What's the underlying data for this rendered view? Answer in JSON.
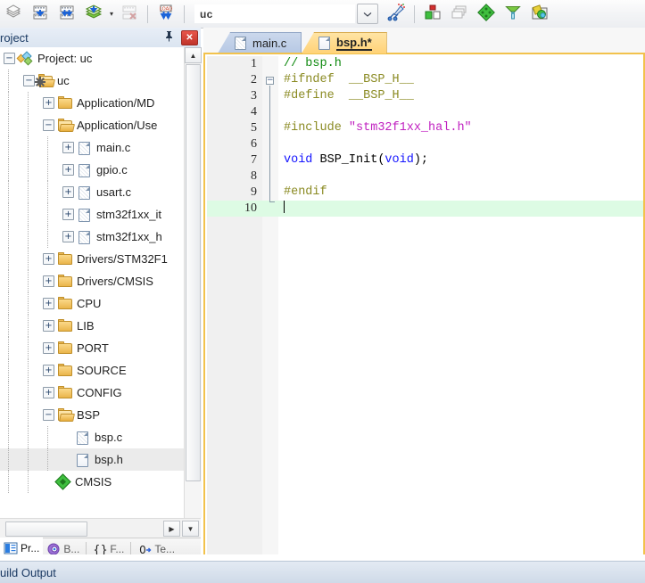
{
  "toolbar": {
    "buttons": [
      {
        "name": "translate-icon",
        "title": "Translate"
      },
      {
        "name": "build-icon",
        "title": "Build"
      },
      {
        "name": "rebuild-icon",
        "title": "Rebuild"
      },
      {
        "name": "batch-build-icon",
        "title": "Batch Build"
      },
      {
        "name": "stop-build-icon",
        "title": "Stop Build"
      },
      {
        "name": "download-icon",
        "title": "Download"
      },
      {
        "name": "target-options-icon",
        "title": "Options for Target"
      },
      {
        "name": "manage-project-items-icon",
        "title": "Manage Project Items"
      },
      {
        "name": "manage-run-time-env-icon",
        "title": "Manage Run-Time Environment"
      },
      {
        "name": "pack-installer-icon",
        "title": "Pack Installer"
      },
      {
        "name": "configuration-wizard-icon",
        "title": "Configuration Wizard"
      }
    ],
    "target_select": {
      "value": "uc",
      "dropdown_icon": "chevron-down-icon"
    },
    "dropdown_caret": "▾"
  },
  "project_panel": {
    "title": "roject",
    "pin_icon": "pin-icon",
    "close_icon": "close-icon",
    "tree": [
      {
        "label": "Project: uc",
        "depth": 0,
        "expander": "minus",
        "icon": "project-root-icon"
      },
      {
        "label": "uc",
        "depth": 1,
        "expander": "minus",
        "icon": "target-folder-icon"
      },
      {
        "label": "Application/MD",
        "depth": 2,
        "expander": "plus",
        "icon": "folder-closed-icon"
      },
      {
        "label": "Application/Use",
        "depth": 2,
        "expander": "minus",
        "icon": "folder-open-icon"
      },
      {
        "label": "main.c",
        "depth": 3,
        "expander": "plus",
        "icon": "file-c-icon"
      },
      {
        "label": "gpio.c",
        "depth": 3,
        "expander": "plus",
        "icon": "file-c-icon"
      },
      {
        "label": "usart.c",
        "depth": 3,
        "expander": "plus",
        "icon": "file-c-icon"
      },
      {
        "label": "stm32f1xx_it",
        "depth": 3,
        "expander": "plus",
        "icon": "file-c-icon"
      },
      {
        "label": "stm32f1xx_h",
        "depth": 3,
        "expander": "plus",
        "icon": "file-c-icon"
      },
      {
        "label": "Drivers/STM32F1",
        "depth": 2,
        "expander": "plus",
        "icon": "folder-closed-icon"
      },
      {
        "label": "Drivers/CMSIS",
        "depth": 2,
        "expander": "plus",
        "icon": "folder-closed-icon"
      },
      {
        "label": "CPU",
        "depth": 2,
        "expander": "plus",
        "icon": "folder-closed-icon"
      },
      {
        "label": "LIB",
        "depth": 2,
        "expander": "plus",
        "icon": "folder-closed-icon"
      },
      {
        "label": "PORT",
        "depth": 2,
        "expander": "plus",
        "icon": "folder-closed-icon"
      },
      {
        "label": "SOURCE",
        "depth": 2,
        "expander": "plus",
        "icon": "folder-closed-icon"
      },
      {
        "label": "CONFIG",
        "depth": 2,
        "expander": "plus",
        "icon": "folder-closed-icon"
      },
      {
        "label": "BSP",
        "depth": 2,
        "expander": "minus",
        "icon": "folder-open-icon"
      },
      {
        "label": "bsp.c",
        "depth": 3,
        "expander": "none",
        "icon": "file-c-icon"
      },
      {
        "label": "bsp.h",
        "depth": 3,
        "expander": "none",
        "icon": "file-h-icon",
        "selected": true
      },
      {
        "label": "CMSIS",
        "depth": 2,
        "expander": "none",
        "icon": "cmsis-icon"
      }
    ],
    "tabs": [
      {
        "label": "Pr...",
        "icon": "project-tab-icon",
        "active": true
      },
      {
        "label": "B...",
        "icon": "books-tab-icon",
        "active": false
      },
      {
        "label": "F...",
        "icon": "functions-tab-icon",
        "active": false
      },
      {
        "label": "Te...",
        "icon": "templates-tab-icon",
        "active": false
      }
    ],
    "scroll_left_icon": "▶",
    "scroll_down_icon": "▼",
    "scroll_up_icon": "▲"
  },
  "editor": {
    "tabs": [
      {
        "label": "main.c",
        "active": false,
        "icon": "file-icon"
      },
      {
        "label": "bsp.h*",
        "active": true,
        "icon": "file-icon"
      }
    ],
    "hscroll_left_icon": "❮",
    "lines": [
      {
        "n": "1",
        "tokens": [
          {
            "t": "// bsp.h",
            "c": "cmt"
          }
        ]
      },
      {
        "n": "2",
        "tokens": [
          {
            "t": "#ifndef  __BSP_H__",
            "c": "pp"
          }
        ],
        "fold": "start"
      },
      {
        "n": "3",
        "tokens": [
          {
            "t": "#define  __BSP_H__",
            "c": "pp"
          }
        ]
      },
      {
        "n": "4",
        "tokens": []
      },
      {
        "n": "5",
        "tokens": [
          {
            "t": "#include ",
            "c": "pp"
          },
          {
            "t": "\"stm32f1xx_hal.h\"",
            "c": "str"
          }
        ]
      },
      {
        "n": "6",
        "tokens": []
      },
      {
        "n": "7",
        "tokens": [
          {
            "t": "void",
            "c": "kw"
          },
          {
            "t": " BSP_Init(",
            "c": "pl"
          },
          {
            "t": "void",
            "c": "kw"
          },
          {
            "t": ");",
            "c": "pl"
          }
        ]
      },
      {
        "n": "8",
        "tokens": []
      },
      {
        "n": "9",
        "tokens": [
          {
            "t": "#endif",
            "c": "pp"
          }
        ]
      },
      {
        "n": "10",
        "tokens": [],
        "current": true,
        "fold": "end",
        "caret": true
      }
    ]
  },
  "build_output": {
    "title": "uild Output"
  },
  "colors": {
    "comment": "#108a10",
    "preprocessor": "#8a8a22",
    "string": "#c020c0",
    "keyword": "#1414ff",
    "current_line": "#ddfbe4",
    "active_tab": "#ffd277",
    "inactive_tab": "#b6c8e4",
    "editor_border": "#f2c24c",
    "selection": "#ebebeb"
  }
}
